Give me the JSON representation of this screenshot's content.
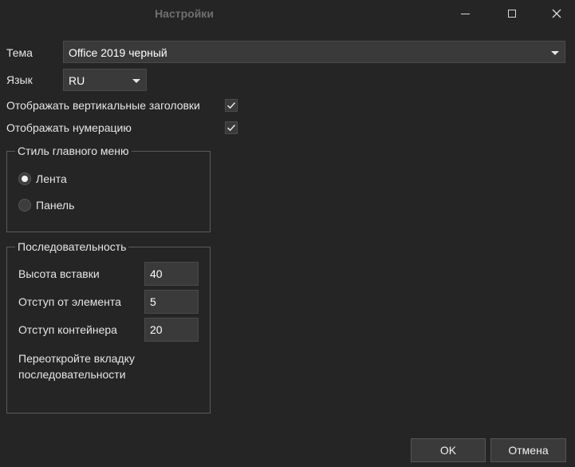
{
  "window": {
    "title": "Настройки"
  },
  "settings": {
    "theme_label": "Тема",
    "theme_value": "Office 2019 черный",
    "language_label": "Язык",
    "language_value": "RU",
    "vertical_headers_label": "Отображать вертикальные заголовки",
    "vertical_headers_checked": true,
    "numbering_label": "Отображать нумерацию",
    "numbering_checked": true
  },
  "menu_style": {
    "title": "Стиль главного меню",
    "options": [
      {
        "label": "Лента",
        "selected": true
      },
      {
        "label": "Панель",
        "selected": false
      }
    ]
  },
  "sequence": {
    "title": "Последовательность",
    "insert_height_label": "Высота вставки",
    "insert_height_value": "40",
    "element_offset_label": "Отступ от элемента",
    "element_offset_value": "5",
    "container_offset_label": "Отступ контейнера",
    "container_offset_value": "20",
    "note": "Переоткройте вкладку последовательности"
  },
  "footer": {
    "ok_label": "OK",
    "cancel_label": "Отмена"
  },
  "colors": {
    "background": "#252525",
    "control": "#3a3a3a",
    "border": "#5b5b5b",
    "text": "#e6e6e6"
  }
}
